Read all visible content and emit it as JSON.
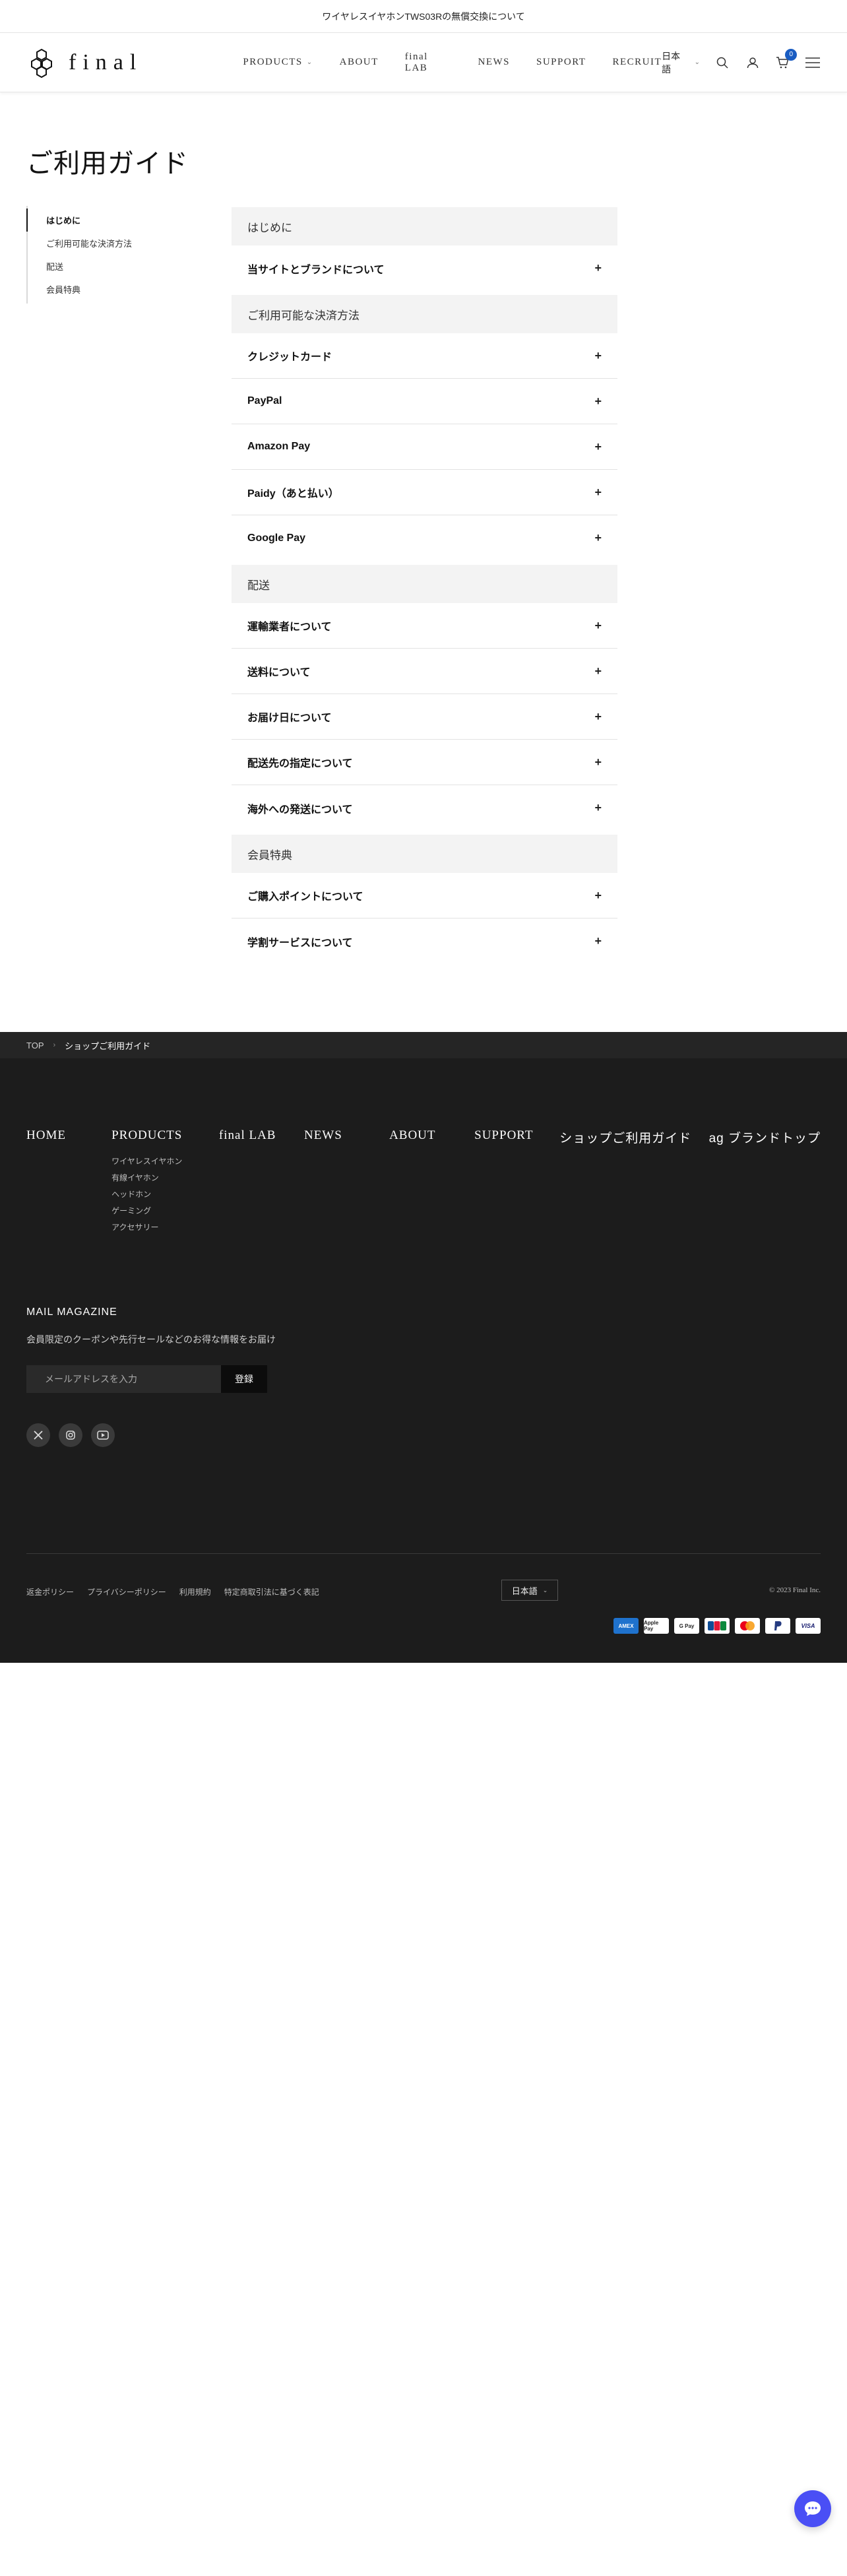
{
  "announcement": "ワイヤレスイヤホンTWS03Rの無償交換について",
  "header": {
    "logo_text": "final",
    "nav": [
      {
        "label": "PRODUCTS",
        "caret": true
      },
      {
        "label": "ABOUT",
        "caret": false
      },
      {
        "label": "final LAB",
        "caret": false
      },
      {
        "label": "NEWS",
        "caret": false
      },
      {
        "label": "SUPPORT",
        "caret": false
      },
      {
        "label": "RECRUIT",
        "caret": false
      }
    ],
    "language": "日本語",
    "cart_count": "0"
  },
  "page_title": "ご利用ガイド",
  "sidenav": {
    "items": [
      "はじめに",
      "ご利用可能な決済方法",
      "配送",
      "会員特典"
    ]
  },
  "sections": [
    {
      "title": "はじめに",
      "items": [
        "当サイトとブランドについて"
      ]
    },
    {
      "title": "ご利用可能な決済方法",
      "items": [
        "クレジットカード",
        "PayPal",
        "Amazon Pay",
        "Paidy（あと払い）",
        "Google Pay"
      ]
    },
    {
      "title": "配送",
      "items": [
        "運輸業者について",
        "送料について",
        "お届け日について",
        "配送先の指定について",
        "海外への発送について"
      ]
    },
    {
      "title": "会員特典",
      "items": [
        "ご購入ポイントについて",
        "学割サービスについて"
      ]
    }
  ],
  "accordion_icon": "+",
  "breadcrumb": {
    "home": "TOP",
    "separator": "›",
    "current": "ショップご利用ガイド"
  },
  "footer": {
    "columns": {
      "home": "HOME",
      "products": "PRODUCTS",
      "products_sub": [
        "ワイヤレスイヤホン",
        "有線イヤホン",
        "ヘッドホン",
        "ゲーミング",
        "アクセサリー"
      ],
      "lab": "final LAB",
      "news": "NEWS",
      "about": "ABOUT",
      "support": "SUPPORT",
      "guide": "ショップご利用ガイド",
      "ag": "ag ブランドトップ"
    },
    "mail_magazine": {
      "title": "MAIL MAGAZINE",
      "description": "会員限定のクーポンや先行セールなどのお得な情報をお届け",
      "placeholder": "メールアドレスを入力",
      "button": "登録"
    },
    "social": [
      "x-icon",
      "instagram-icon",
      "youtube-icon"
    ],
    "legal": [
      "返金ポリシー",
      "プライバシーポリシー",
      "利用規約",
      "特定商取引法に基づく表記"
    ],
    "language": "日本語",
    "copyright": "© 2023 Final Inc.",
    "payments": [
      "AMEX",
      "Apple Pay",
      "G Pay",
      "JCB",
      "Mastercard",
      "PayPal",
      "VISA"
    ]
  },
  "colors": {
    "accent": "#1a5dc2",
    "footer_bg": "#1c1c1c",
    "chat": "#4a4ff5"
  }
}
